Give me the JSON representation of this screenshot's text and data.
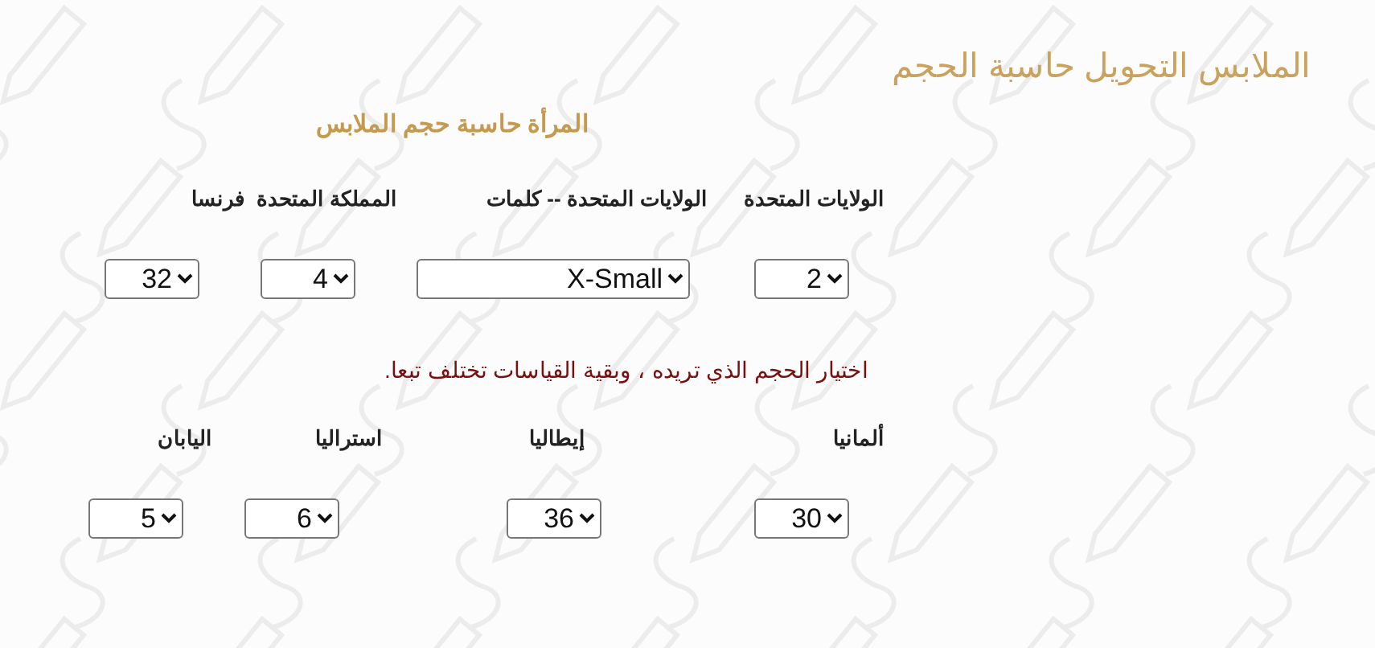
{
  "title": "الملابس التحويل حاسبة الحجم",
  "subtitle": "المرأة حاسبة حجم الملابس",
  "primary_sizes": [
    {
      "label": "الولايات المتحدة",
      "value": "2"
    },
    {
      "label": "الولايات المتحدة -- كلمات",
      "value": "X-Small"
    },
    {
      "label": "المملكة المتحدة",
      "value": "4"
    },
    {
      "label": "فرنسا",
      "value": "32"
    }
  ],
  "note": "اختيار الحجم الذي تريده ، وبقية القياسات تختلف تبعا.",
  "secondary_sizes": [
    {
      "label": "ألمانيا",
      "value": "30"
    },
    {
      "label": "إيطاليا",
      "value": "36"
    },
    {
      "label": "استراليا",
      "value": "6"
    },
    {
      "label": "اليابان",
      "value": "5"
    }
  ]
}
